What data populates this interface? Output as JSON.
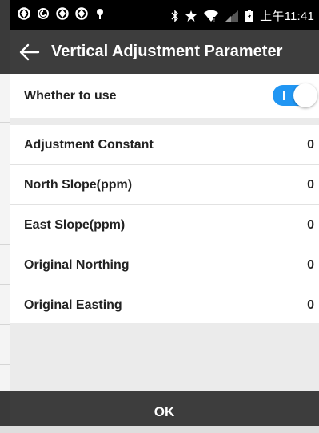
{
  "status_bar": {
    "time": "上午11:41",
    "left_icons": [
      "sync-icon",
      "sync-alt-icon",
      "sync-icon",
      "sync-icon",
      "usb-icon"
    ],
    "right_icons": [
      "bluetooth-icon",
      "star-icon",
      "wifi-icon",
      "signal-icon",
      "battery-icon"
    ]
  },
  "header": {
    "title": "Vertical Adjustment Parameter"
  },
  "toggle_row": {
    "label": "Whether to use",
    "enabled": true
  },
  "params": [
    {
      "label": "Adjustment Constant",
      "value": "0"
    },
    {
      "label": "North Slope(ppm)",
      "value": "0"
    },
    {
      "label": "East Slope(ppm)",
      "value": "0"
    },
    {
      "label": "Original Northing",
      "value": "0"
    },
    {
      "label": "Original Easting",
      "value": "0"
    }
  ],
  "footer": {
    "ok_label": "OK"
  },
  "colors": {
    "header_bg": "#3d3d3d",
    "toggle_on": "#2196f3",
    "page_bg": "#ebebeb"
  }
}
